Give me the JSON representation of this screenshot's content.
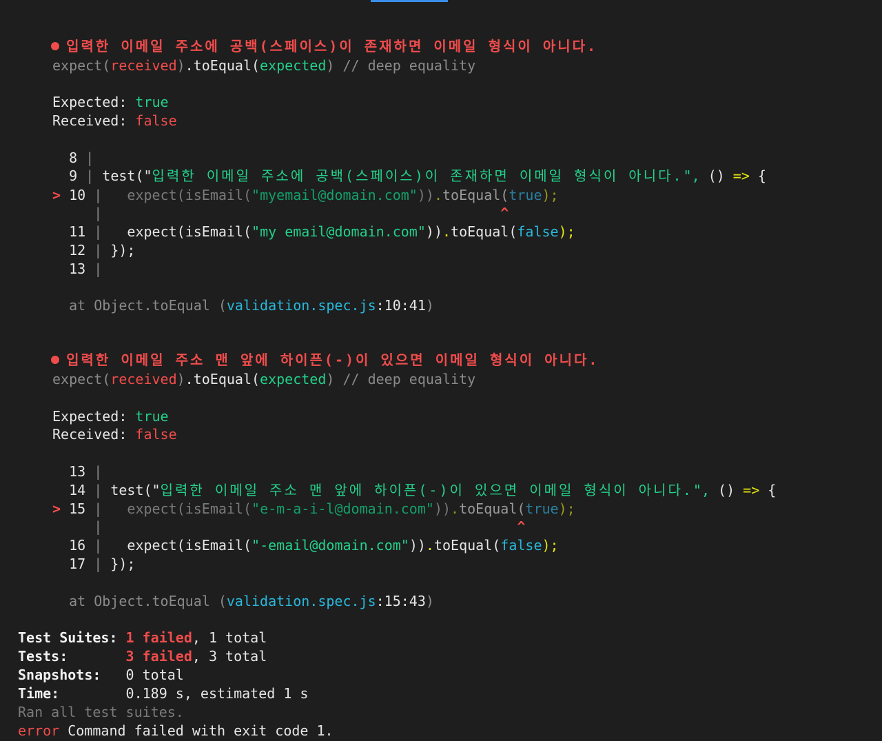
{
  "failures": [
    {
      "title": "입력한 이메일 주소에 공백(스페이스)이 존재하면 이메일 형식이 아니다.",
      "matcher": {
        "expect": "expect(",
        "received": "received",
        "close": ")",
        "method": ".toEqual(",
        "expected": "expected",
        "close2": ")",
        "comment": " // deep equality"
      },
      "expected_label": "Expected: ",
      "expected_value": "true",
      "received_label": "Received: ",
      "received_value": "false",
      "code": [
        {
          "num": "8",
          "marker": " ",
          "pipe": "|"
        },
        {
          "num": "9",
          "marker": " ",
          "pipe": "|",
          "prefix": " test(\"",
          "str": "입력한 이메일 주소에 공백(스페이스)이 존재하면 이메일 형식이 아니다.",
          "suffix1": "\", ",
          "args": "() ",
          "arrow": "=>",
          "brace": " {"
        },
        {
          "num": "10",
          "marker": ">",
          "pipe": "|",
          "a": "   expect(isEmail(",
          "str": "\"myemail@domain.com\"",
          "b": "))",
          "c": ".toEqual(",
          "val": "true",
          "d": ");"
        },
        {
          "num": "",
          "pipe": "|",
          "caret": "^"
        },
        {
          "num": "11",
          "marker": " ",
          "pipe": "|",
          "a": "   expect(isEmail(",
          "str": "\"my email@domain.com\"",
          "b": "))",
          "c": ".toEqual(",
          "val": "false",
          "d": ");"
        },
        {
          "num": "12",
          "marker": " ",
          "pipe": "|",
          "close": " });"
        },
        {
          "num": "13",
          "marker": " ",
          "pipe": "|"
        }
      ],
      "at": {
        "prefix": "at Object.toEqual ",
        "paren_open": "(",
        "file": "validation.spec.js",
        "loc": ":10:41",
        "paren_close": ")"
      }
    },
    {
      "title": "입력한 이메일 주소 맨 앞에 하이픈(-)이 있으면 이메일 형식이 아니다.",
      "matcher": {
        "expect": "expect(",
        "received": "received",
        "close": ")",
        "method": ".toEqual(",
        "expected": "expected",
        "close2": ")",
        "comment": " // deep equality"
      },
      "expected_label": "Expected: ",
      "expected_value": "true",
      "received_label": "Received: ",
      "received_value": "false",
      "code": [
        {
          "num": "13",
          "marker": " ",
          "pipe": "|"
        },
        {
          "num": "14",
          "marker": " ",
          "pipe": "|",
          "prefix": " test(\"",
          "str": "입력한 이메일 주소 맨 앞에 하이픈(-)이 있으면 이메일 형식이 아니다.",
          "suffix1": "\", ",
          "args": "() ",
          "arrow": "=>",
          "brace": " {"
        },
        {
          "num": "15",
          "marker": ">",
          "pipe": "|",
          "a": "   expect(isEmail(",
          "str": "\"e-m-a-i-l@domain.com\"",
          "b": "))",
          "c": ".toEqual(",
          "val": "true",
          "d": ");"
        },
        {
          "num": "",
          "pipe": "|",
          "caret": "^"
        },
        {
          "num": "16",
          "marker": " ",
          "pipe": "|",
          "a": "   expect(isEmail(",
          "str": "\"-email@domain.com\"",
          "b": "))",
          "c": ".toEqual(",
          "val": "false",
          "d": ");"
        },
        {
          "num": "17",
          "marker": " ",
          "pipe": "|",
          "close": " });"
        }
      ],
      "at": {
        "prefix": "at Object.toEqual ",
        "paren_open": "(",
        "file": "validation.spec.js",
        "loc": ":15:43",
        "paren_close": ")"
      }
    }
  ],
  "summary": {
    "suites_label": "Test Suites: ",
    "suites_failed": "1 failed",
    "suites_total": ", 1 total",
    "tests_label": "Tests:       ",
    "tests_failed": "3 failed",
    "tests_total": ", 3 total",
    "snapshots_label": "Snapshots:   ",
    "snapshots_value": "0 total",
    "time_label": "Time:        ",
    "time_value": "0.189 s, estimated 1 s",
    "ran": "Ran all test suites.",
    "error_word": "error",
    "error_msg": " Command failed with exit code 1."
  },
  "colors": {
    "background": "#1e1e1e",
    "fail_red": "#f14c4c",
    "pass_green": "#23d18b",
    "link_blue": "#29b8db",
    "tab_indicator": "#3b8eea"
  }
}
